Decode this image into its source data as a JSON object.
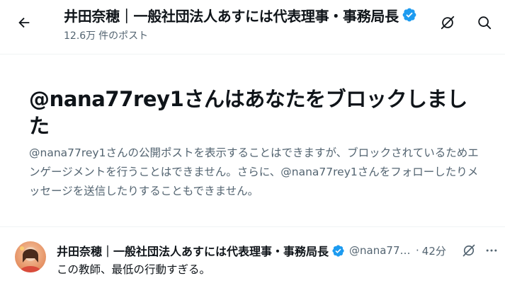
{
  "header": {
    "title": "井田奈穂｜一般社団法人あすには代表理事・事務局長",
    "post_count": "12.6万",
    "post_count_label": "件のポスト",
    "icons": [
      "back-arrow-icon",
      "verified-badge-icon",
      "grok-icon",
      "search-icon"
    ]
  },
  "block_notice": {
    "title": "@nana77rey1さんはあなたをブロックしました",
    "description": "@nana77rey1さんの公開ポストを表示することはできますが、ブロックされているためエンゲージメントを行うことはできません。さらに、@nana77rey1さんをフォローしたりメッセージを送信したりすることもできません。"
  },
  "tweet": {
    "display_name": "井田奈穂｜一般社団法人あすには代表理事・事務局長",
    "handle": "@nana77rey1",
    "separator": "·",
    "time": "42分",
    "text": "この教師、最低の行動すぎる。",
    "icons": [
      "avatar",
      "verified-badge-icon",
      "grok-icon",
      "more-icon"
    ]
  },
  "colors": {
    "text_primary": "#0f1419",
    "text_secondary": "#536471",
    "verified_blue": "#1d9bf0",
    "divider": "#eff3f4"
  }
}
